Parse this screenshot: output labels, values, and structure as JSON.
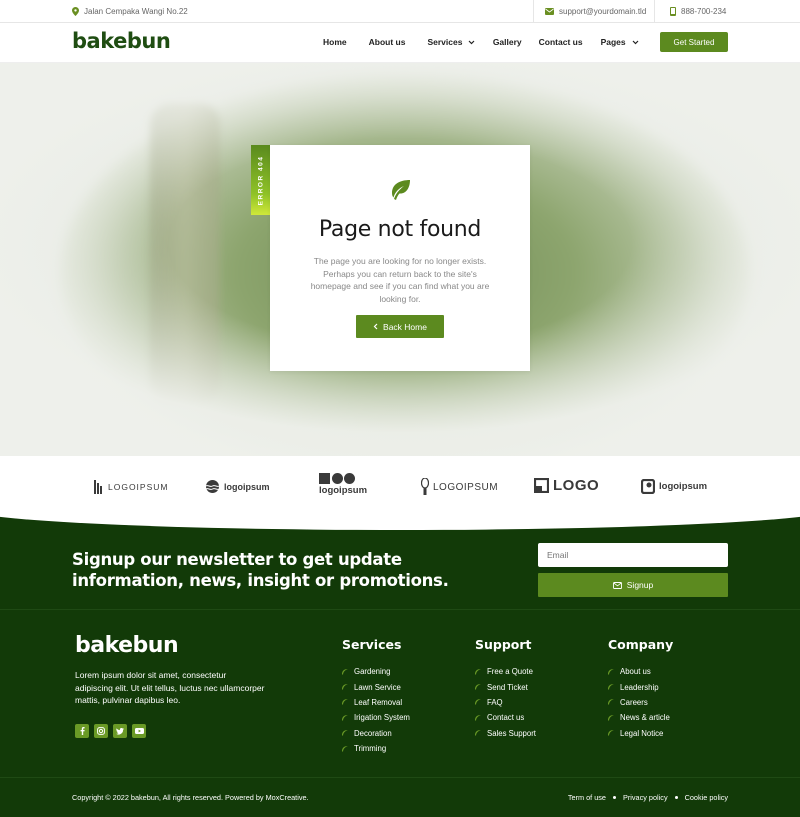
{
  "topbar": {
    "address": "Jalan Cempaka Wangi No.22",
    "email": "support@yourdomain.tld",
    "phone": "888-700-234"
  },
  "header": {
    "logo": "bakebun",
    "nav": [
      {
        "label": "Home",
        "dropdown": false
      },
      {
        "label": "About us",
        "dropdown": false
      },
      {
        "label": "Services",
        "dropdown": true
      },
      {
        "label": "Gallery",
        "dropdown": false
      },
      {
        "label": "Contact us",
        "dropdown": false
      },
      {
        "label": "Pages",
        "dropdown": true
      }
    ],
    "cta": "Get Started"
  },
  "error": {
    "badge": "ERROR 404",
    "title": "Page not found",
    "message": "The page you are looking for no longer exists. Perhaps you can return back to the site's homepage and see if you can find what you are looking for.",
    "button": "Back Home"
  },
  "logos": [
    {
      "text": "LOGOIPSUM",
      "icon": "bars-logo-icon"
    },
    {
      "text": "logoipsum",
      "icon": "waves-logo-icon"
    },
    {
      "text": "logoipsum",
      "icon": "shapes-logo-icon"
    },
    {
      "text": "LOGOIPSUM",
      "icon": "bulb-logo-icon"
    },
    {
      "text": "LOGO",
      "icon": "box-logo-icon"
    },
    {
      "text": "logoipsum",
      "icon": "square-logo-icon"
    }
  ],
  "newsletter": {
    "title": "Signup our newsletter to get update information, news, insight or promotions.",
    "email_placeholder": "Email",
    "button": "Signup"
  },
  "footer": {
    "logo": "bakebun",
    "description": "Lorem ipsum dolor sit amet, consectetur adipiscing elit. Ut elit tellus, luctus nec ullamcorper mattis, pulvinar dapibus leo.",
    "socials": [
      "facebook-icon",
      "instagram-icon",
      "twitter-icon",
      "youtube-icon"
    ],
    "columns": [
      {
        "title": "Services",
        "items": [
          "Gardening",
          "Lawn Service",
          "Leaf Removal",
          "Irigation System",
          "Decoration",
          "Trimming"
        ]
      },
      {
        "title": "Support",
        "items": [
          "Free a Quote",
          "Send Ticket",
          "FAQ",
          "Contact us",
          "Sales Support"
        ]
      },
      {
        "title": "Company",
        "items": [
          "About us",
          "Leadership",
          "Careers",
          "News & article",
          "Legal Notice"
        ]
      }
    ],
    "copyright": "Copyright © 2022 bakebun, All rights reserved. Powered by MoxCreative.",
    "legal": [
      "Term of use",
      "Privacy policy",
      "Cookie policy"
    ]
  },
  "colors": {
    "brand_green": "#5c8a1f",
    "footer_bg": "#123a08",
    "dark_green_logo": "#1f4d12"
  }
}
